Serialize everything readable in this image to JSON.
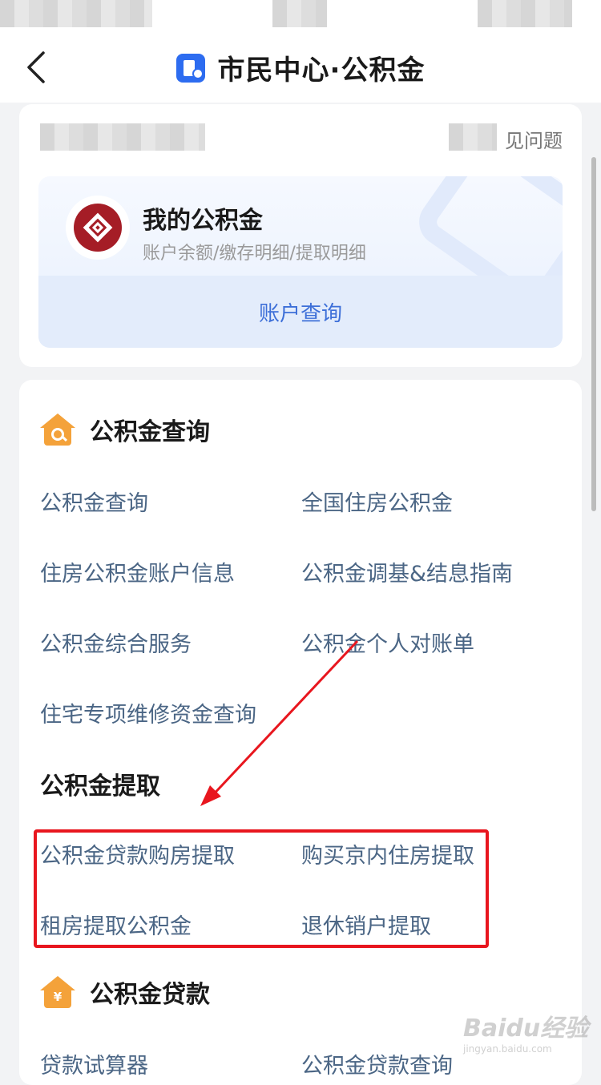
{
  "header": {
    "title": "市民中心·公积金",
    "back_icon": "chevron-left-icon",
    "app_icon": "document-user-icon"
  },
  "top_card": {
    "faq_text": "见问题",
    "account": {
      "title": "我的公积金",
      "subtitle": "账户余额/缴存明细/提取明细",
      "button": "账户查询",
      "logo_color": "#a51d26"
    }
  },
  "sections": {
    "query": {
      "title": "公积金查询",
      "icon": "house-search-icon",
      "items": [
        "公积金查询",
        "全国住房公积金",
        "住房公积金账户信息",
        "公积金调基&结息指南",
        "公积金综合服务",
        "公积金个人对账单",
        "住宅专项维修资金查询"
      ]
    },
    "withdraw": {
      "title": "公积金提取",
      "items": [
        "公积金贷款购房提取",
        "购买京内住房提取",
        "租房提取公积金",
        "退休销户提取"
      ]
    },
    "loan": {
      "title": "公积金贷款",
      "icon": "house-yuan-icon",
      "items": [
        "贷款试算器",
        "公积金贷款查询"
      ]
    }
  },
  "watermark": {
    "brand": "Baidu经验",
    "url": "jingyan.baidu.com"
  },
  "colors": {
    "accent": "#2d6cf0",
    "link": "#4b6685",
    "section_icon": "#f4a23a",
    "annotation": "#e8161e"
  }
}
